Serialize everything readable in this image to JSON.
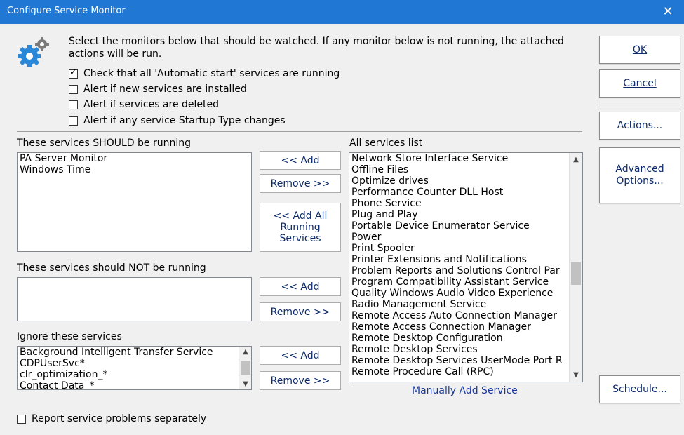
{
  "window": {
    "title": "Configure Service Monitor",
    "close_glyph": "✕"
  },
  "intro": {
    "text": "Select the monitors below that should be watched.  If any monitor below is not running, the attached actions will be run."
  },
  "options": [
    {
      "label": "Check that all 'Automatic start' services are running",
      "checked": true
    },
    {
      "label": "Alert if new services are installed",
      "checked": false
    },
    {
      "label": "Alert if services are deleted",
      "checked": false
    },
    {
      "label": "Alert if any service Startup Type changes",
      "checked": false
    }
  ],
  "should_run": {
    "label": "These services SHOULD be running",
    "items": [
      "PA Server Monitor",
      "Windows Time"
    ],
    "add_label": "<< Add",
    "remove_label": "Remove >>",
    "add_all_line1": "<< Add All",
    "add_all_line2": "Running",
    "add_all_line3": "Services"
  },
  "should_not_run": {
    "label": "These services should NOT be running",
    "items": [],
    "add_label": "<< Add",
    "remove_label": "Remove >>"
  },
  "ignore": {
    "label": "Ignore these services",
    "items": [
      "Background Intelligent Transfer Service",
      "CDPUserSvc*",
      "clr_optimization_*",
      "Contact Data_*"
    ],
    "add_label": "<< Add",
    "remove_label": "Remove >>"
  },
  "all_services": {
    "label": "All services list",
    "items": [
      "Network Store Interface Service",
      "Offline Files",
      "Optimize drives",
      "Performance Counter DLL Host",
      "Phone Service",
      "Plug and Play",
      "Portable Device Enumerator Service",
      "Power",
      "Print Spooler",
      "Printer Extensions and Notifications",
      "Problem Reports and Solutions Control Par",
      "Program Compatibility Assistant Service",
      "Quality Windows Audio Video Experience",
      "Radio Management Service",
      "Remote Access Auto Connection Manager",
      "Remote Access Connection Manager",
      "Remote Desktop Configuration",
      "Remote Desktop Services",
      "Remote Desktop Services UserMode Port R",
      "Remote Procedure Call (RPC)"
    ],
    "manual_add_label": "Manually Add Service"
  },
  "report_separately": {
    "label": "Report service problems separately",
    "checked": false
  },
  "buttons": {
    "ok": "OK",
    "cancel": "Cancel",
    "actions": "Actions...",
    "advanced_line1": "Advanced",
    "advanced_line2": "Options...",
    "schedule": "Schedule..."
  },
  "icons": {
    "settings": "gear-icon",
    "scroll_up": "▲",
    "scroll_down": "▼"
  },
  "colors": {
    "titlebar": "#2078d4",
    "link": "#1a3a9a"
  }
}
